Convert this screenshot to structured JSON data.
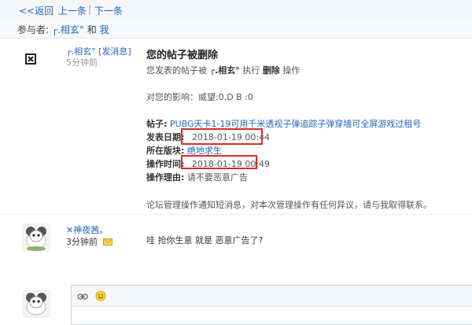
{
  "nav": {
    "back": "<<返回",
    "prev": "上一条",
    "sep": "|",
    "next": "下一条"
  },
  "participants": {
    "label": "参与者:",
    "user1": "┌.相玄°",
    "and": "和",
    "user2": "我"
  },
  "message1": {
    "sender": "┌.相玄°",
    "send_msg": "[发消息]",
    "time": "5分钟前",
    "title": "您的帖子被删除",
    "action_pre": "您发表的帖子被",
    "actor": "┌.相玄°",
    "action_mid": "执行",
    "action_word": "删除",
    "action_post": "操作",
    "impact": "对您的影响：威望:0,D B :0",
    "post_label": "帖子:",
    "post_title": "PUBG天卡1-19可用千米透视子弹追踪子弹穿墙可全屏游戏过租号",
    "date_label": "发表日期:",
    "date_value": "2018-01-19 00:44",
    "forum_label": "所在版块:",
    "forum_value": "绝地求生",
    "optime_label": "操作时间:",
    "optime_value": "2018-01-19 00:49",
    "reason_label": "操作理由:",
    "reason_value": "请不要恶意广告",
    "footer": "论坛管理操作通知短消息，对本次管理操作有任何异议，请与我取得联系。"
  },
  "message2": {
    "sender": "✕神夜茜。",
    "time": "3分钟前",
    "content": "哇 抢你生意 就是 恶意广告了?"
  },
  "composer": {
    "link_icon": "link-icon",
    "emoji_icon": "emoji-icon"
  },
  "colors": {
    "link": "#2266bb",
    "highlight_box": "#e02a2a"
  }
}
